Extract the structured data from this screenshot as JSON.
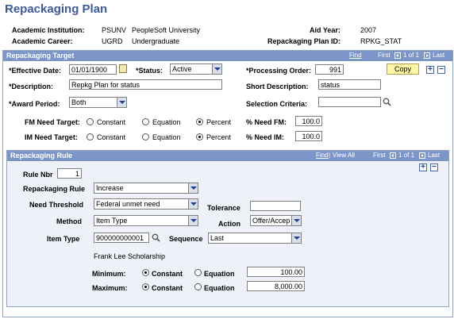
{
  "page": {
    "title": "Repackaging Plan"
  },
  "header": {
    "institution_label": "Academic Institution:",
    "institution_code": "PSUNV",
    "institution_name": "PeopleSoft University",
    "aid_year_label": "Aid Year:",
    "aid_year": "2007",
    "career_label": "Academic Career:",
    "career_code": "UGRD",
    "career_name": "Undergraduate",
    "plan_id_label": "Repackaging Plan ID:",
    "plan_id": "RPKG_STAT"
  },
  "target": {
    "title": "Repackaging Target",
    "nav": {
      "find": "Find",
      "first": "First",
      "range": "1 of 1",
      "last": "Last"
    },
    "effective_date_label": "*Effective Date:",
    "effective_date": "01/01/1900",
    "status_label": "*Status:",
    "status": "Active",
    "processing_order_label": "*Processing Order:",
    "processing_order": "991",
    "copy_label": "Copy",
    "description_label": "*Description:",
    "description": "Repkg Plan for status",
    "short_description_label": "Short Description:",
    "short_description": "status",
    "award_period_label": "*Award Period:",
    "award_period": "Both",
    "selection_criteria_label": "Selection Criteria:",
    "selection_criteria": "",
    "fm_label": "FM Need Target:",
    "im_label": "IM Need Target:",
    "opt_constant": "Constant",
    "opt_equation": "Equation",
    "opt_percent": "Percent",
    "fm_selected": "Percent",
    "im_selected": "Percent",
    "pct_fm_label": "% Need FM:",
    "pct_fm": "100.0",
    "pct_im_label": "% Need IM:",
    "pct_im": "100.0"
  },
  "rule": {
    "title": "Repackaging Rule",
    "nav": {
      "find": "Find",
      "view_all": "View All",
      "first": "First",
      "range": "1 of 1",
      "last": "Last"
    },
    "rule_nbr_label": "Rule Nbr",
    "rule_nbr": "1",
    "repackaging_rule_label": "Repackaging Rule",
    "repackaging_rule": "Increase",
    "need_threshold_label": "Need Threshold",
    "need_threshold": "Federal unmet need",
    "tolerance_label": "Tolerance",
    "tolerance": "",
    "method_label": "Method",
    "method": "Item Type",
    "action_label": "Action",
    "action": "Offer/Accep",
    "item_type_label": "Item Type",
    "item_type": "900000000001",
    "sequence_label": "Sequence",
    "sequence": "Last",
    "item_desc": "Frank Lee Scholarship",
    "minimum_label": "Minimum:",
    "minimum": "100.00",
    "minimum_selected": "Constant",
    "maximum_label": "Maximum:",
    "maximum": "8,000.00",
    "maximum_selected": "Constant",
    "opt_constant": "Constant",
    "opt_equation": "Equation"
  },
  "colors": {
    "title": "#3c5a99",
    "panel_header": "#7d96c9",
    "copy_button": "#fff6a8"
  }
}
